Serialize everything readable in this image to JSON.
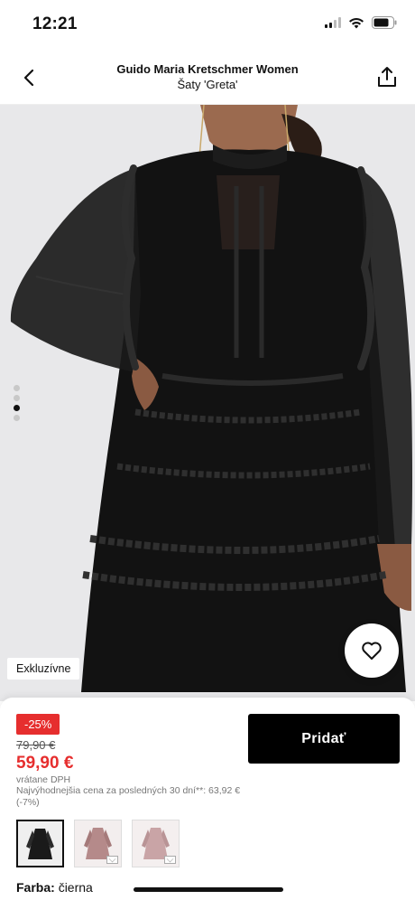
{
  "status_bar": {
    "time": "12:21"
  },
  "header": {
    "brand": "Guido Maria Kretschmer Women",
    "product": "Šaty 'Greta'"
  },
  "gallery": {
    "total_images": 4,
    "active_index": 3,
    "badge": "Exkluzívne"
  },
  "pricing": {
    "discount": "-25%",
    "old_price": "79,90 €",
    "new_price": "59,90 €",
    "vat_note": "vrátane DPH",
    "lowest_price_note": "Najvýhodnejšia cena za posledných 30 dní**: 63,92 € (-7%)"
  },
  "actions": {
    "add_label": "Pridať"
  },
  "variants": {
    "thumbnails": [
      {
        "name": "black-dress",
        "color": "#1a1a1a",
        "selected": true
      },
      {
        "name": "mauve-dress-1",
        "color": "#b58a8a",
        "selected": false
      },
      {
        "name": "mauve-dress-2",
        "color": "#c9a4a6",
        "selected": false
      }
    ]
  },
  "color": {
    "label": "Farba:",
    "value": "čierna"
  },
  "colors": {
    "sale_red": "#e62e2e",
    "button_black": "#000000"
  }
}
